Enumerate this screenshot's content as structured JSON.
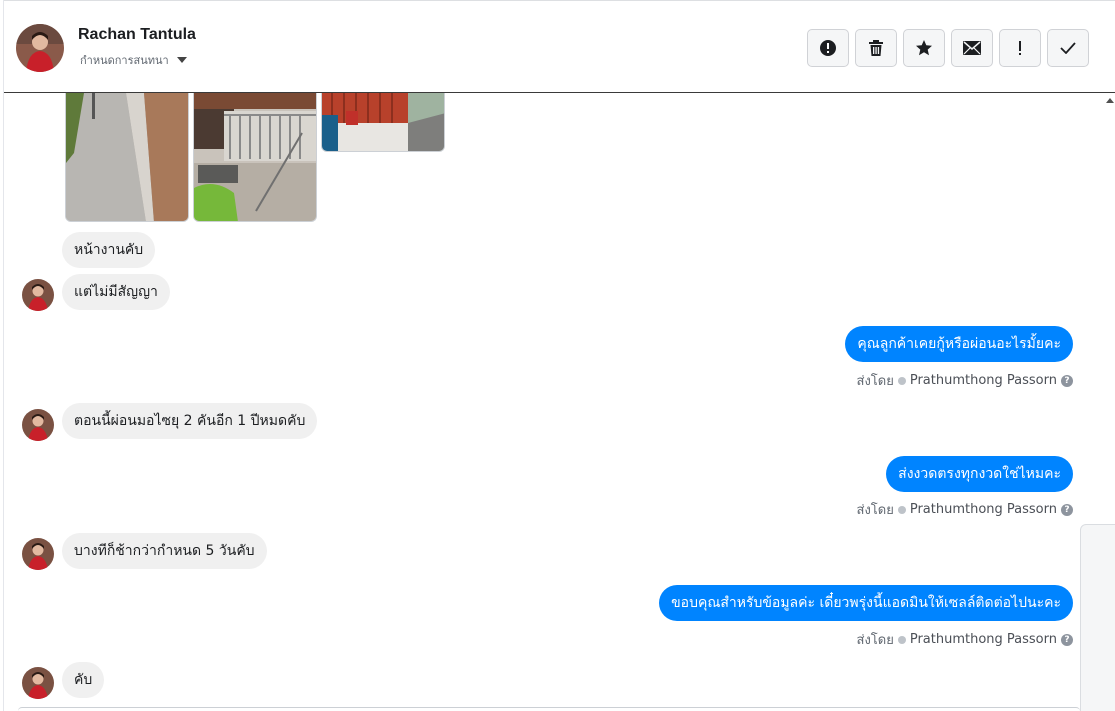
{
  "contact": {
    "name": "Rachan Tantula",
    "assign_label": "กำหนดการสนทนา"
  },
  "toolbar": {
    "buttons": [
      {
        "icon": "alert-circle-icon"
      },
      {
        "icon": "trash-icon"
      },
      {
        "icon": "star-icon"
      },
      {
        "icon": "envelope-icon"
      },
      {
        "icon": "exclamation-icon"
      },
      {
        "icon": "checkmark-icon"
      }
    ]
  },
  "messages": [
    {
      "direction": "in",
      "text": "หน้างานคับ",
      "avatar": false
    },
    {
      "direction": "in",
      "text": "แต่ไม่มีสัญญา",
      "avatar": true
    },
    {
      "direction": "out",
      "text": "คุณลูกค้าเคยกู้หรือผ่อนอะไรมั้ยคะ",
      "sent_by_label": "ส่งโดย",
      "sender": "Prathumthong Passorn"
    },
    {
      "direction": "in",
      "text": "ตอนนี้ผ่อนมอไซยุ  2  คันอีก  1  ปีหมดคับ",
      "avatar": true
    },
    {
      "direction": "out",
      "text": "ส่งงวดตรงทุกงวดใช่ไหมคะ",
      "sent_by_label": "ส่งโดย",
      "sender": "Prathumthong Passorn"
    },
    {
      "direction": "in",
      "text": "บางทีก็ช้ากว่ากำหนด  5   วันคับ",
      "avatar": true
    },
    {
      "direction": "out",
      "text": "ขอบคุณสำหรับข้อมูลค่ะ เดี๋ยวพรุ่งนี้แอดมินให้เซลล์ติดต่อไปนะคะ",
      "sent_by_label": "ส่งโดย",
      "sender": "Prathumthong Passorn"
    },
    {
      "direction": "in",
      "text": "คับ",
      "avatar": true
    }
  ],
  "colors": {
    "outgoing_bubble": "#0084ff",
    "incoming_bubble": "#f0f0f0"
  }
}
